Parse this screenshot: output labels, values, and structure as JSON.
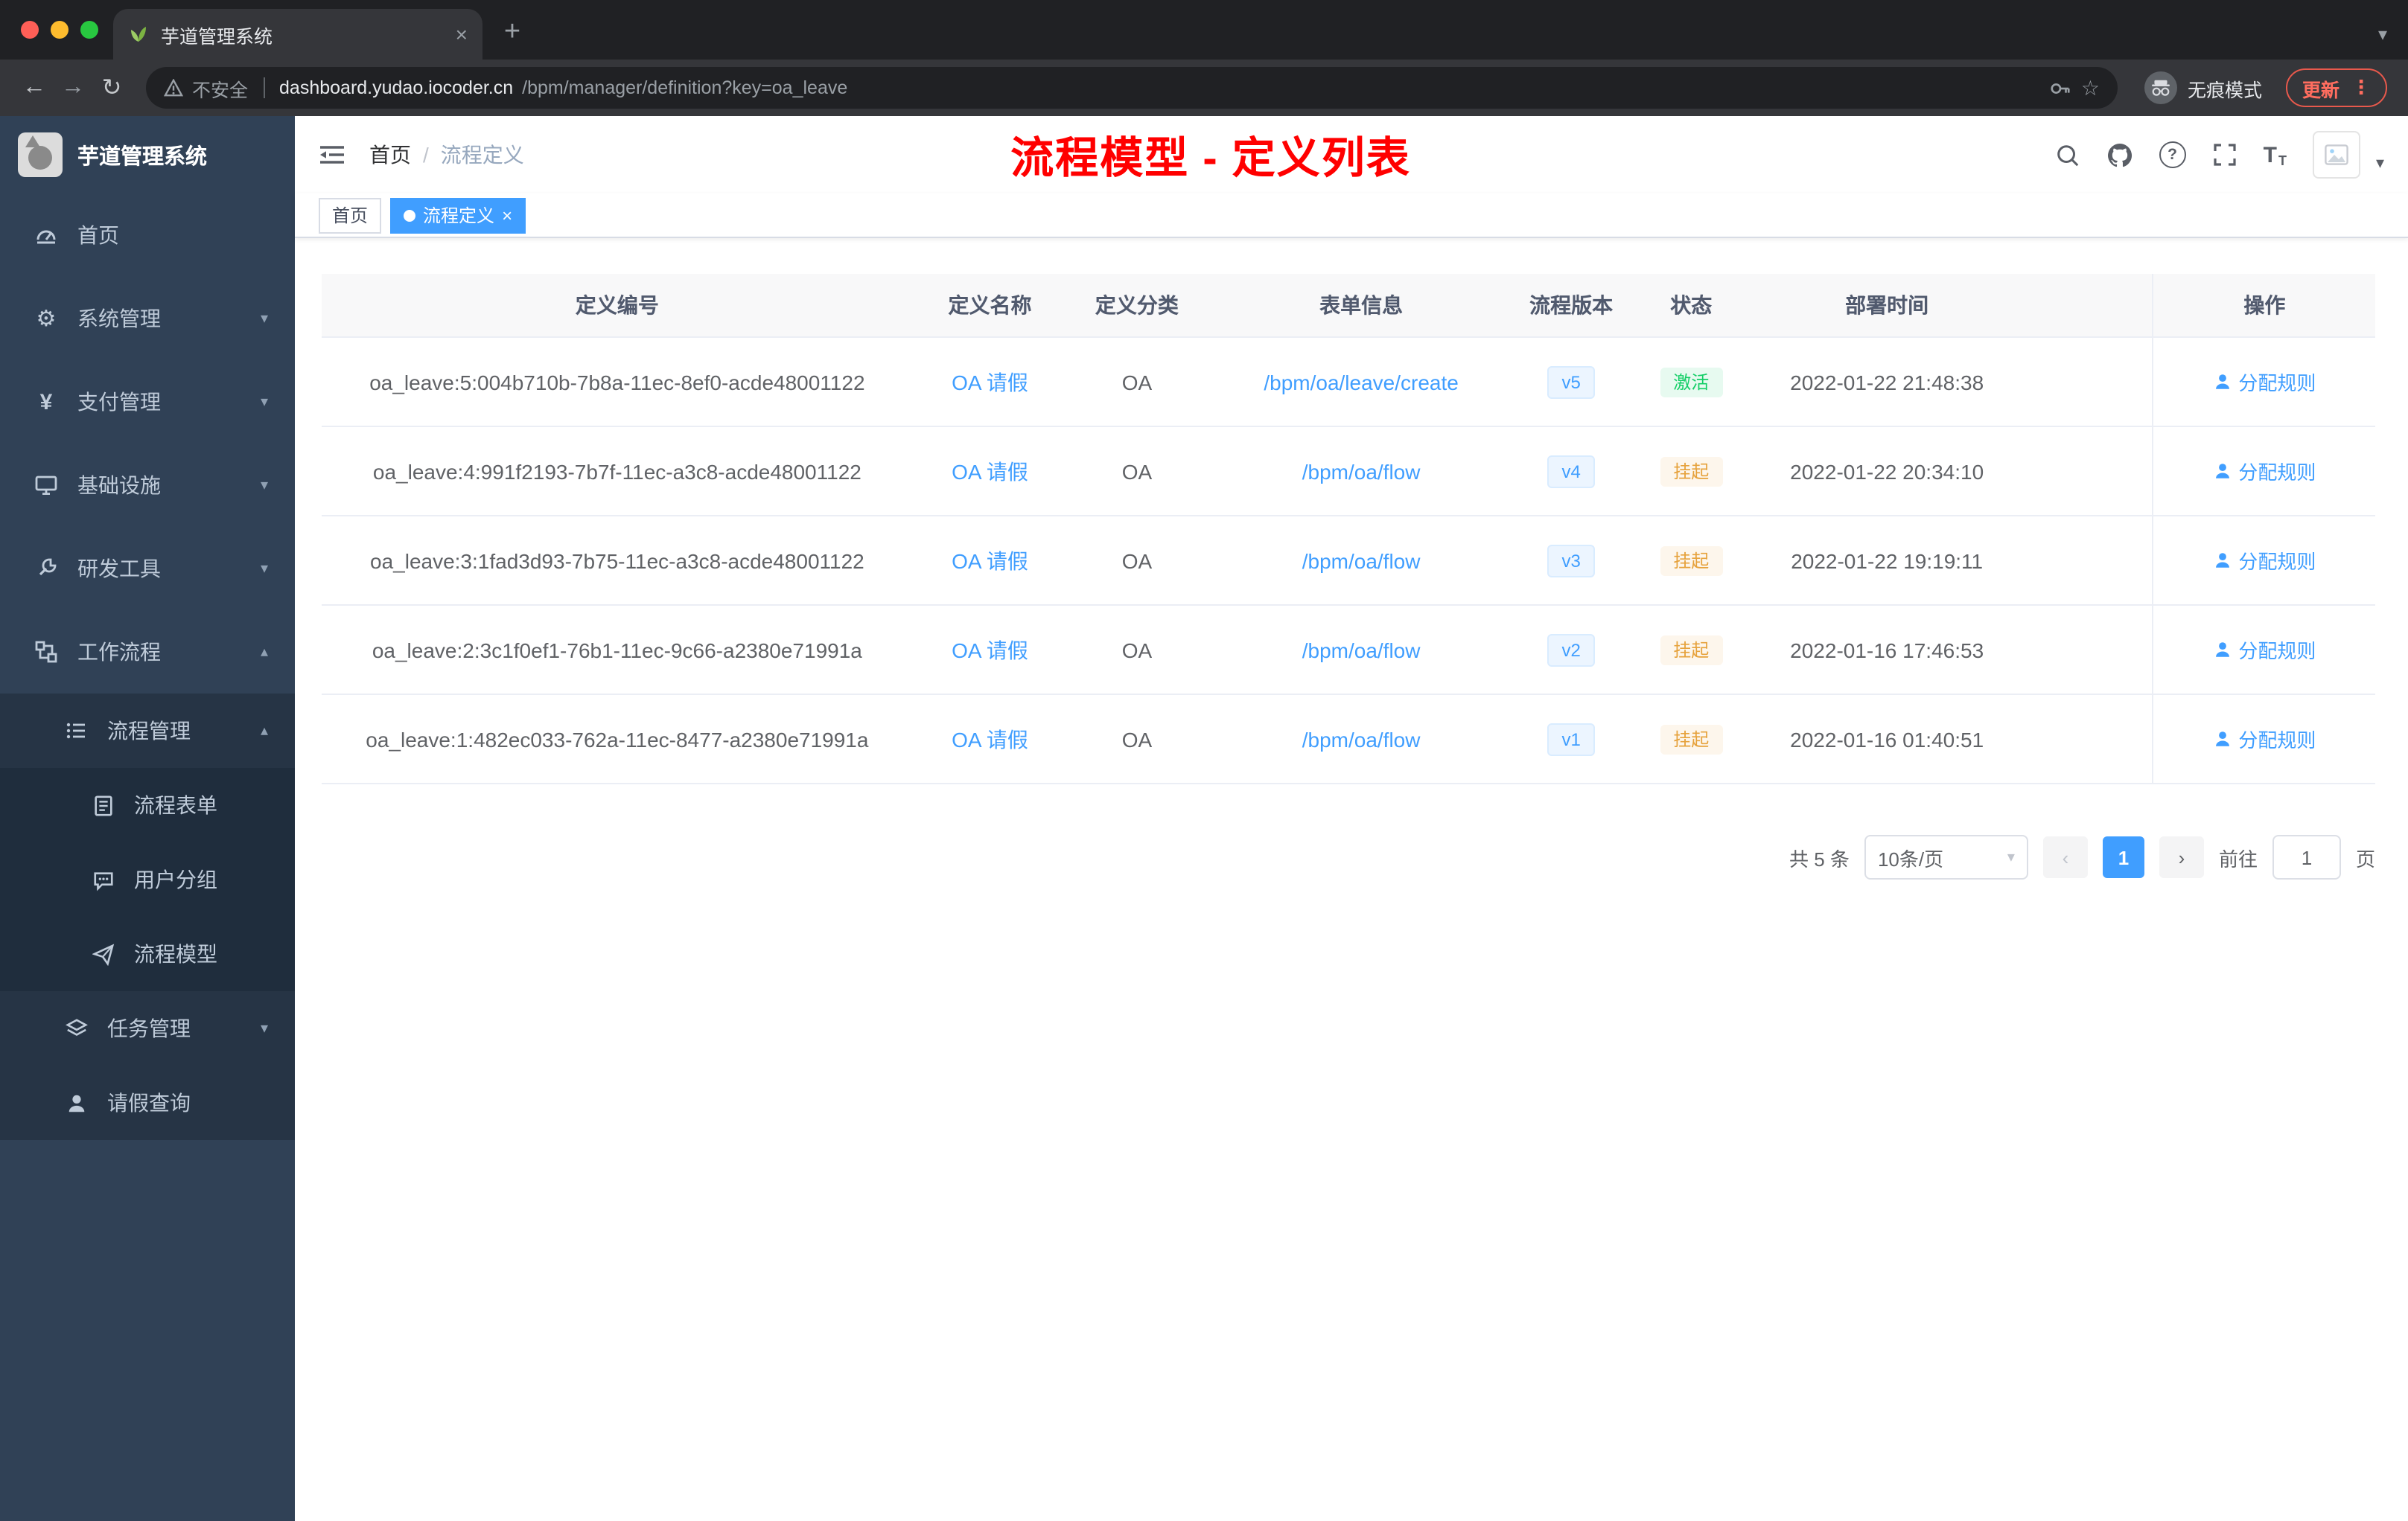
{
  "colors": {
    "accent": "#409eff",
    "annotation_red": "#ff0000",
    "sidebar_bg": "#304156",
    "success_text": "#13ce66",
    "warning_text": "#e6a23c"
  },
  "icons": {
    "close": "×",
    "new_tab": "+",
    "back": "←",
    "forward": "→",
    "reload": "↻",
    "star": "☆",
    "kebab": "⋮",
    "chevron_down": "▾",
    "chevron_up": "▴",
    "gear": "⚙",
    "yen": "¥",
    "question": "?",
    "font_large": "T",
    "font_small": "T",
    "dot": "●",
    "breadcrumb_sep": "/"
  },
  "browser": {
    "tab_title": "芋道管理系统",
    "security_label": "不安全",
    "url_domain": "dashboard.yudao.iocoder.cn",
    "url_path": "/bpm/manager/definition?key=oa_leave",
    "incognito_label": "无痕模式",
    "update_label": "更新"
  },
  "sidebar": {
    "logo_title": "芋道管理系统",
    "items": [
      {
        "label": "首页"
      },
      {
        "label": "系统管理"
      },
      {
        "label": "支付管理"
      },
      {
        "label": "基础设施"
      },
      {
        "label": "研发工具"
      },
      {
        "label": "工作流程"
      },
      {
        "label": "流程管理"
      },
      {
        "label": "流程表单"
      },
      {
        "label": "用户分组"
      },
      {
        "label": "流程模型"
      },
      {
        "label": "任务管理"
      },
      {
        "label": "请假查询"
      }
    ]
  },
  "header": {
    "breadcrumb_home": "首页",
    "breadcrumb_current": "流程定义",
    "annotation": "流程模型 - 定义列表"
  },
  "tags": {
    "home": "首页",
    "active": "流程定义"
  },
  "table": {
    "columns": [
      "定义编号",
      "定义名称",
      "定义分类",
      "表单信息",
      "流程版本",
      "状态",
      "部署时间",
      "操作"
    ],
    "action_label": "分配规则",
    "rows": [
      {
        "id": "oa_leave:5:004b710b-7b8a-11ec-8ef0-acde48001122",
        "name": "OA 请假",
        "category": "OA",
        "form": "/bpm/oa/leave/create",
        "version": "v5",
        "status": "激活",
        "status_type": "success",
        "time": "2022-01-22 21:48:38"
      },
      {
        "id": "oa_leave:4:991f2193-7b7f-11ec-a3c8-acde48001122",
        "name": "OA 请假",
        "category": "OA",
        "form": "/bpm/oa/flow",
        "version": "v4",
        "status": "挂起",
        "status_type": "warning",
        "time": "2022-01-22 20:34:10"
      },
      {
        "id": "oa_leave:3:1fad3d93-7b75-11ec-a3c8-acde48001122",
        "name": "OA 请假",
        "category": "OA",
        "form": "/bpm/oa/flow",
        "version": "v3",
        "status": "挂起",
        "status_type": "warning",
        "time": "2022-01-22 19:19:11"
      },
      {
        "id": "oa_leave:2:3c1f0ef1-76b1-11ec-9c66-a2380e71991a",
        "name": "OA 请假",
        "category": "OA",
        "form": "/bpm/oa/flow",
        "version": "v2",
        "status": "挂起",
        "status_type": "warning",
        "time": "2022-01-16 17:46:53"
      },
      {
        "id": "oa_leave:1:482ec033-762a-11ec-8477-a2380e71991a",
        "name": "OA 请假",
        "category": "OA",
        "form": "/bpm/oa/flow",
        "version": "v1",
        "status": "挂起",
        "status_type": "warning",
        "time": "2022-01-16 01:40:51"
      }
    ]
  },
  "pagination": {
    "total": "共 5 条",
    "page_size": "10条/页",
    "current_page": "1",
    "goto_label": "前往",
    "goto_value": "1",
    "page_unit": "页"
  }
}
